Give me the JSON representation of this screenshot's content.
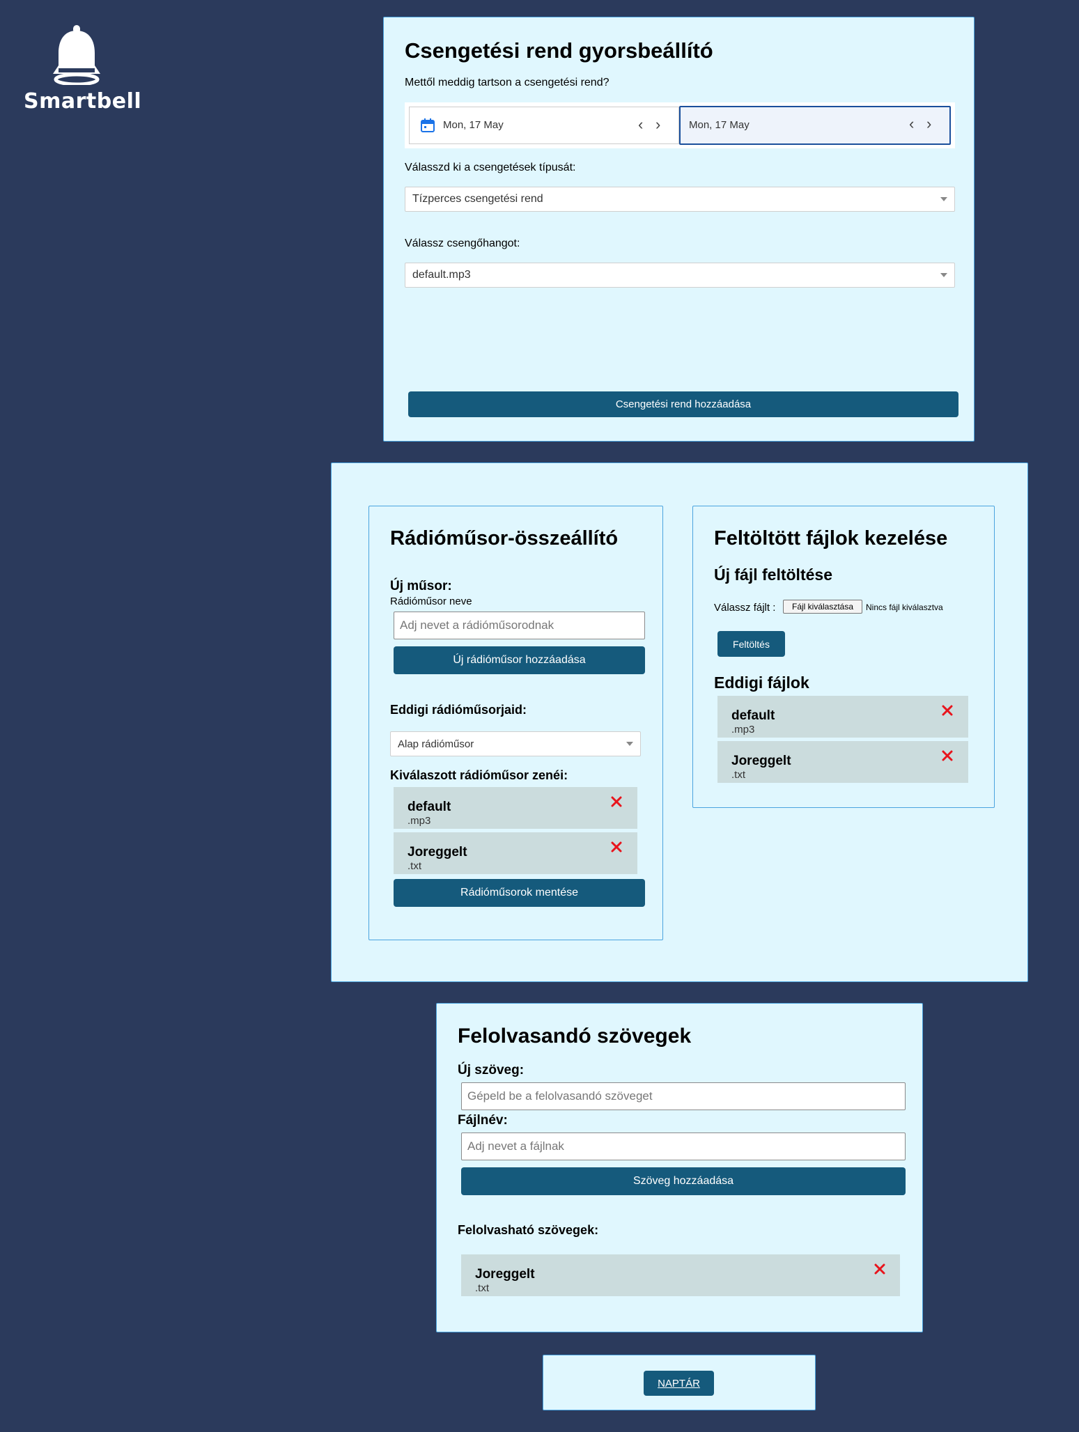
{
  "logo": {
    "text": "Smartbell"
  },
  "bell_section": {
    "title": "Csengetési rend gyorsbeállító",
    "range_question": "Mettől meddig tartson a csengetési rend?",
    "date_from": "Mon, 17 May",
    "date_to": "Mon, 17 May",
    "type_question": "Válasszd ki a csengetések típusát:",
    "type_selected": "Tízperces csengetési rend",
    "sound_question": "Válassz csengőhangot:",
    "sound_selected": "default.mp3",
    "add_button": "Csengetési rend hozzáadása"
  },
  "radio_section": {
    "title": "Rádióműsor-összeállító",
    "new_label": "Új műsor:",
    "name_label": "Rádióműsor neve",
    "name_placeholder": "Adj nevet a rádióműsorodnak",
    "add_button": "Új rádióműsor hozzáadása",
    "existing_label": "Eddigi rádióműsorjaid:",
    "existing_selected": "Alap rádióműsor",
    "songs_label": "Kiválaszott rádióműsor zenéi:",
    "songs": [
      {
        "name": "default",
        "ext": ".mp3"
      },
      {
        "name": "Joreggelt",
        "ext": ".txt"
      }
    ],
    "save_button": "Rádióműsorok mentése"
  },
  "files_section": {
    "title": "Feltöltött fájlok kezelése",
    "upload_title": "Új fájl feltöltése",
    "choose_label": "Válassz fájlt :",
    "choose_button": "Fájl kiválasztása",
    "no_file": "Nincs fájl kiválasztva",
    "upload_button": "Feltöltés",
    "list_title": "Eddigi fájlok",
    "files": [
      {
        "name": "default",
        "ext": ".mp3"
      },
      {
        "name": "Joreggelt",
        "ext": ".txt"
      }
    ]
  },
  "texts_section": {
    "title": "Felolvasandó szövegek",
    "new_label": "Új szöveg:",
    "text_placeholder": "Gépeld be a felolvasandó szöveget",
    "filename_label": "Fájlnév:",
    "filename_placeholder": "Adj nevet a fájlnak",
    "add_button": "Szöveg hozzáadása",
    "list_label": "Felolvasható szövegek:",
    "texts": [
      {
        "name": "Joreggelt",
        "ext": ".txt"
      }
    ]
  },
  "calendar": {
    "button": "NAPTÁR"
  },
  "colors": {
    "background": "#2b3a5c",
    "panel": "#e0f7fe",
    "panel_border": "#4aa3df",
    "button": "#155a7c",
    "card": "#cbdcdd",
    "delete": "#e8141c"
  }
}
